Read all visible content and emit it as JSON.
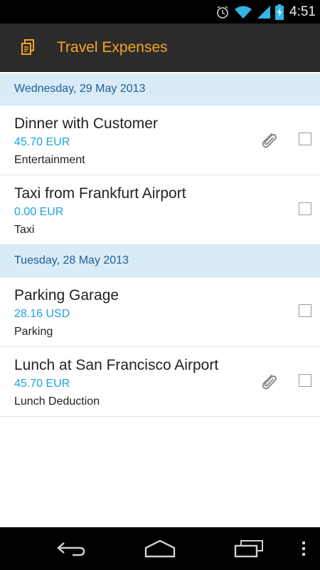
{
  "status_bar": {
    "time": "4:51",
    "icons": [
      "alarm-clock-icon",
      "wifi-icon",
      "cell-signal-icon",
      "battery-charging-icon"
    ]
  },
  "action_bar": {
    "app_icon": "receipt-icon",
    "title": "Travel Expenses",
    "title_color": "#f6a623"
  },
  "sections": [
    {
      "date": "Wednesday, 29 May 2013",
      "items": [
        {
          "title": "Dinner with Customer",
          "amount": "45.70 EUR",
          "category": "Entertainment",
          "attachment": true,
          "checked": false
        },
        {
          "title": "Taxi from Frankfurt Airport",
          "amount": "0.00 EUR",
          "category": "Taxi",
          "attachment": false,
          "checked": false
        }
      ]
    },
    {
      "date": "Tuesday, 28 May 2013",
      "items": [
        {
          "title": "Parking Garage",
          "amount": "28.16 USD",
          "category": "Parking",
          "attachment": false,
          "checked": false
        },
        {
          "title": "Lunch at San Francisco Airport",
          "amount": "45.70 EUR",
          "category": "Lunch Deduction",
          "attachment": true,
          "checked": false
        }
      ]
    }
  ],
  "colors": {
    "date_header_bg": "#d9ebf7",
    "date_header_text": "#1f5e96",
    "amount_text": "#1ea2dc"
  },
  "nav_bar": {
    "icons": [
      "back-icon",
      "home-icon",
      "recent-apps-icon",
      "overflow-menu-icon"
    ]
  }
}
